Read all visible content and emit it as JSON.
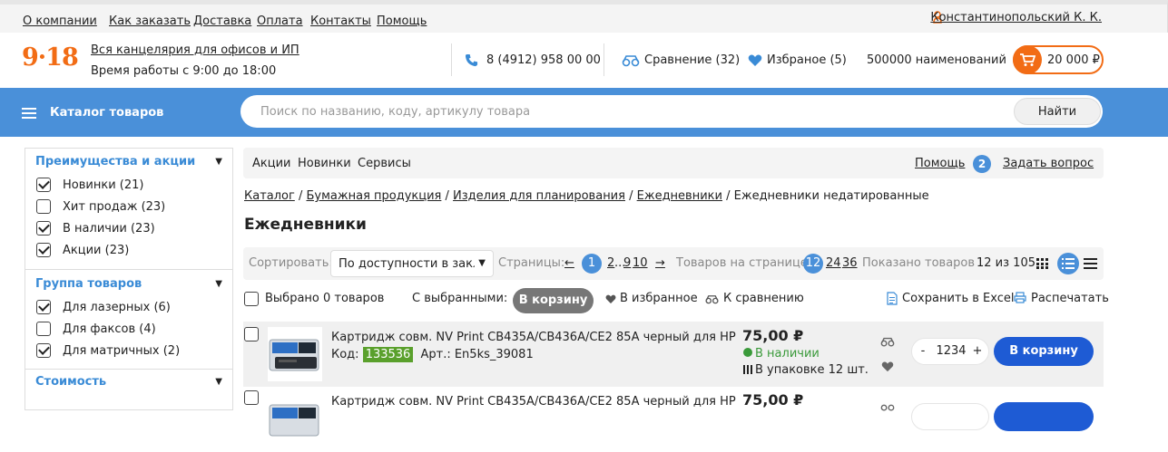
{
  "topnav": {
    "items": [
      "О компании",
      "Как заказать",
      "Доставка",
      "Оплата",
      "Контакты",
      "Помощь"
    ],
    "user": "Константинопольский К. К."
  },
  "header": {
    "logo": "9·18",
    "tagline": "Вся канцелярия для офисов и ИП",
    "hours": "Время работы с 9:00 до 18:00",
    "phone": "8 (4912) 958 00 00",
    "compare": "Сравнение (32)",
    "favorites": "Избраное (5)",
    "items_count": "500000 наименований",
    "cart_total": "20 000 ₽"
  },
  "search": {
    "catalog_label": "Каталог товаров",
    "placeholder": "Поиск по названию, коду, артикулу товара",
    "button": "Найти"
  },
  "sidebar": {
    "sections": [
      {
        "title": "Преимущества и акции",
        "items": [
          {
            "label": "Новинки (21)",
            "checked": true
          },
          {
            "label": "Хит продаж (23)",
            "checked": false
          },
          {
            "label": "В наличии (23)",
            "checked": true
          },
          {
            "label": "Акции (23)",
            "checked": true
          }
        ]
      },
      {
        "title": "Группа товаров",
        "items": [
          {
            "label": "Для лазерных (6)",
            "checked": true
          },
          {
            "label": "Для факсов (4)",
            "checked": false
          },
          {
            "label": "Для матричных (2)",
            "checked": true
          }
        ]
      },
      {
        "title": "Стоимость",
        "items": []
      }
    ]
  },
  "main_nav": {
    "links": [
      "Акции",
      "Новинки",
      "Сервисы"
    ],
    "help": "Помощь",
    "help_badge": "2",
    "ask": "Задать вопрос"
  },
  "breadcrumb": {
    "items": [
      "Каталог",
      "Бумажная продукция",
      "Изделия для планирования",
      "Ежедневники"
    ],
    "current": "Ежедневники недатированные",
    "sep": "/"
  },
  "page_title": "Ежедневники",
  "toolbar": {
    "sort_label": "Сортировать:",
    "sort_value": "По доступности в закл",
    "pages_label": "Страницы:",
    "prev": "←",
    "page_current": "1",
    "page_2": "2",
    "ellipsis": "...",
    "page_9": "9",
    "page_10": "10",
    "next": "→",
    "per_page_label": "Товаров на странице:",
    "per_page_current": "12",
    "per_page_24": "24",
    "per_page_36": "36",
    "shown_label": "Показано товаров :",
    "shown_value": "12 из 105"
  },
  "actions": {
    "selected": "Выбрано 0 товаров",
    "with_selected": "С выбранными:",
    "to_cart": "В корзину",
    "to_fav": "В избранное",
    "to_compare": "К сравнению",
    "excel": "Сохранить в Excel",
    "print": "Распечатать"
  },
  "products": [
    {
      "name": "Картридж совм. NV Print  CB435A/CB436A/CE2 85A черный для HP",
      "code_label": "Код:",
      "code": "133536",
      "article": "Арт.: En5ks_39081",
      "price": "75,00 ₽",
      "stock": "В наличии",
      "pack": "В упаковке 12 шт.",
      "qty": "1234",
      "minus": "-",
      "plus": "+",
      "cart_btn": "В корзину"
    },
    {
      "name": "Картридж совм. NV Print  CB435A/CB436A/CE2 85A черный для HP",
      "price": "75,00 ₽"
    }
  ],
  "colors": {
    "accent": "#f26c15",
    "blue": "#4a90d9",
    "button_blue": "#1e5bd4",
    "code_green": "#5aa02c"
  }
}
